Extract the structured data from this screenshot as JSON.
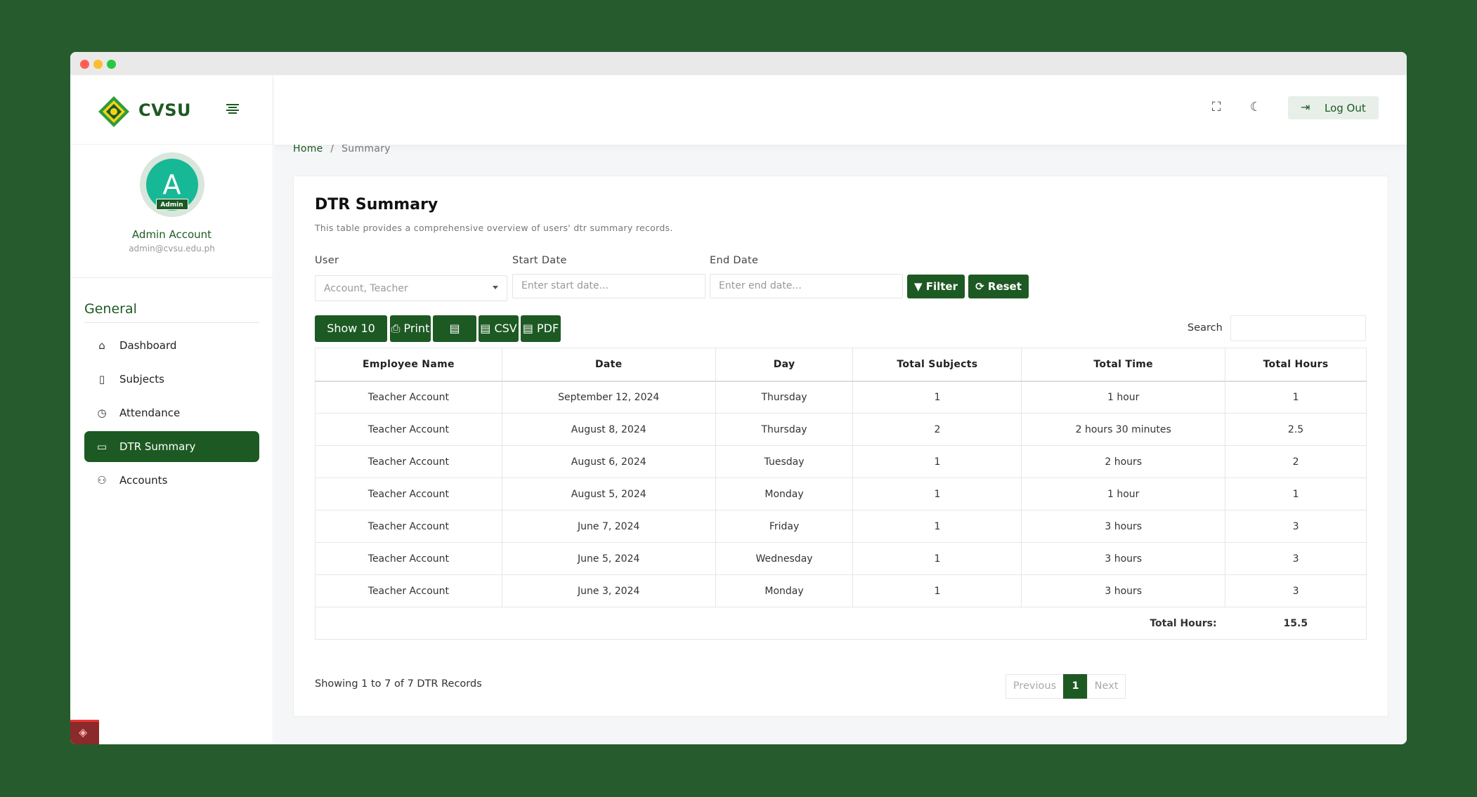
{
  "brand": {
    "name": "CVSU"
  },
  "profile": {
    "initial": "A",
    "badge": "Admin",
    "name": "Admin Account",
    "email": "admin@cvsu.edu.ph"
  },
  "sidebar": {
    "section_title": "General",
    "items": [
      {
        "label": "Dashboard",
        "icon": "home-icon"
      },
      {
        "label": "Subjects",
        "icon": "book-icon"
      },
      {
        "label": "Attendance",
        "icon": "clock-icon"
      },
      {
        "label": "DTR Summary",
        "icon": "monitor-icon",
        "active": true
      },
      {
        "label": "Accounts",
        "icon": "users-icon"
      }
    ]
  },
  "topbar": {
    "logout_label": "Log Out"
  },
  "breadcrumb": {
    "home": "Home",
    "separator": "/",
    "current": "Summary"
  },
  "card": {
    "title": "DTR Summary",
    "subtitle": "This table provides a comprehensive overview of users' dtr summary records."
  },
  "filters": {
    "user_label": "User",
    "user_value": "Account, Teacher",
    "start_label": "Start Date",
    "start_placeholder": "Enter start date...",
    "end_label": "End Date",
    "end_placeholder": "Enter end date...",
    "filter_button": "Filter",
    "reset_button": "Reset"
  },
  "toolbar": {
    "show_rows": "Show 10 rows",
    "print": "Print",
    "excel": "Excel",
    "csv": "CSV",
    "pdf": "PDF",
    "search_label": "Search"
  },
  "table": {
    "headers": [
      "Employee Name",
      "Date",
      "Day",
      "Total Subjects",
      "Total Time",
      "Total Hours"
    ],
    "rows": [
      [
        "Teacher Account",
        "September 12, 2024",
        "Thursday",
        "1",
        "1 hour",
        "1"
      ],
      [
        "Teacher Account",
        "August 8, 2024",
        "Thursday",
        "2",
        "2 hours 30 minutes",
        "2.5"
      ],
      [
        "Teacher Account",
        "August 6, 2024",
        "Tuesday",
        "1",
        "2 hours",
        "2"
      ],
      [
        "Teacher Account",
        "August 5, 2024",
        "Monday",
        "1",
        "1 hour",
        "1"
      ],
      [
        "Teacher Account",
        "June 7, 2024",
        "Friday",
        "1",
        "3 hours",
        "3"
      ],
      [
        "Teacher Account",
        "June 5, 2024",
        "Wednesday",
        "1",
        "3 hours",
        "3"
      ],
      [
        "Teacher Account",
        "June 3, 2024",
        "Monday",
        "1",
        "3 hours",
        "3"
      ]
    ],
    "total_label": "Total Hours:",
    "total_value": "15.5"
  },
  "footer": {
    "info": "Showing 1 to 7 of 7 DTR Records",
    "previous": "Previous",
    "page": "1",
    "next": "Next"
  },
  "colors": {
    "brand_green": "#1d5a23",
    "avatar": "#17b896",
    "background": "#265b2e"
  }
}
